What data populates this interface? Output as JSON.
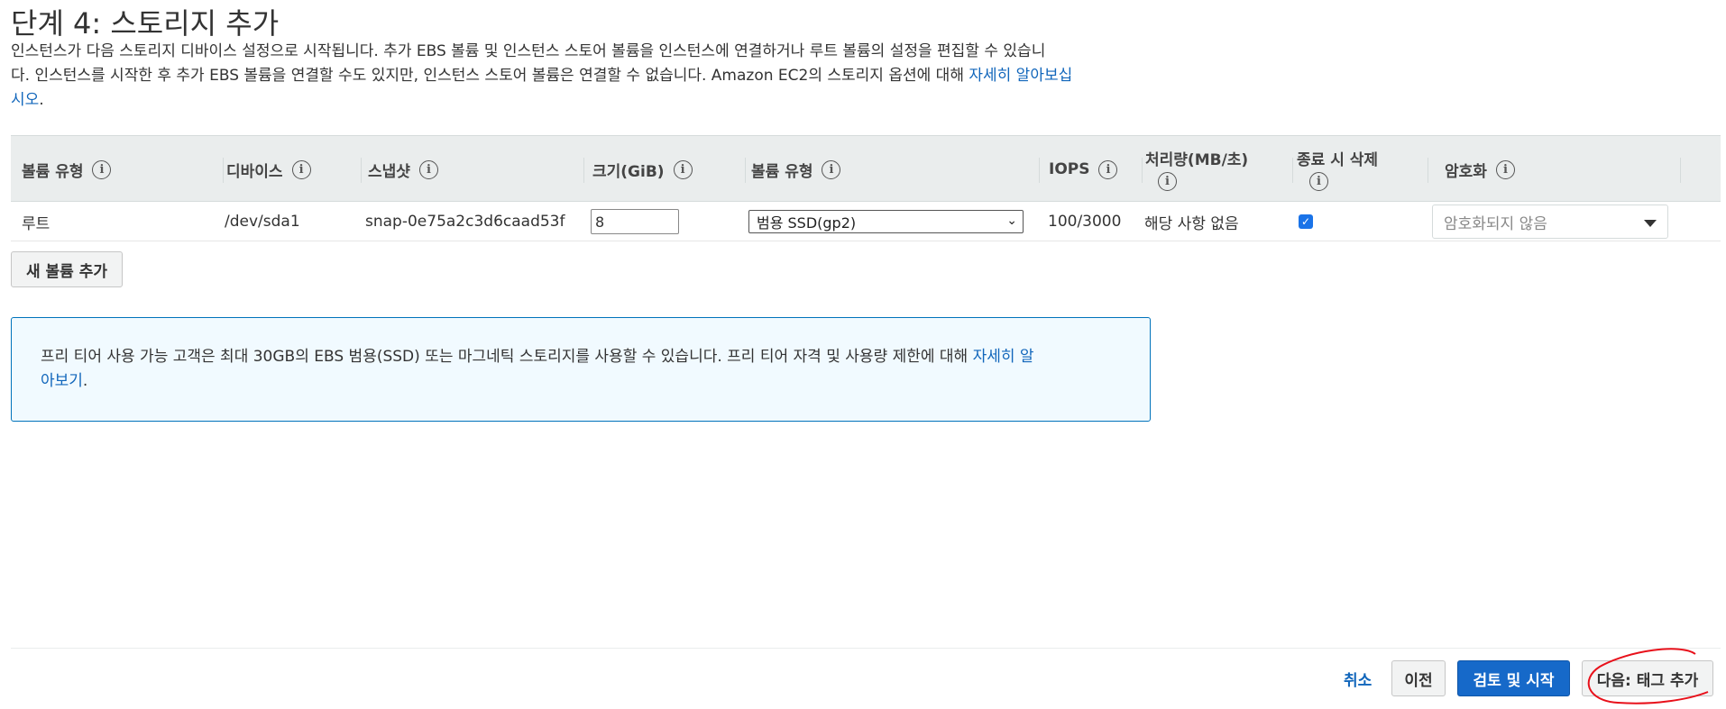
{
  "page": {
    "title": "단계 4: 스토리지 추가",
    "desc_line1": "인스턴스가 다음 스토리지 디바이스 설정으로 시작됩니다. 추가 EBS 볼륨 및 인스턴스 스토어 볼륨을 인스턴스에 연결하거나 루트 볼륨의 설정을 편집할 수 있습니",
    "desc_line2": "다. 인스턴스를 시작한 후 추가 EBS 볼륨을 연결할 수도 있지만, 인스턴스 스토어 볼륨은 연결할 수 없습니다. Amazon EC2의 스토리지 옵션에 대해 ",
    "desc_link_part1": "자세히 알아보십",
    "desc_link_part2": "시오",
    "desc_end": "."
  },
  "table": {
    "headers": {
      "volume_type": "볼륨 유형",
      "device": "디바이스",
      "snapshot": "스냅샷",
      "size": "크기(GiB)",
      "vol_type": "볼륨 유형",
      "iops": "IOPS",
      "throughput": "처리량(MB/초)",
      "delete_on_termination": "종료 시 삭제",
      "encryption": "암호화"
    },
    "info_glyph": "i",
    "row": {
      "volume_type": "루트",
      "device": "/dev/sda1",
      "snapshot": "snap-0e75a2c3d6caad53f",
      "size": "8",
      "vol_type": "범용 SSD(gp2)",
      "iops": "100/3000",
      "throughput": "해당 사항 없음",
      "delete_on_termination": true,
      "encryption": "암호화되지 않음"
    }
  },
  "add_volume_label": "새 볼륨 추가",
  "notice": {
    "text": "프리 티어 사용 가능 고객은 최대 30GB의 EBS 범용(SSD) 또는 마그네틱 스토리지를 사용할 수 있습니다. 프리 티어 자격 및 사용량 제한에 대해 ",
    "link_part1": "자세히 알",
    "link_part2": "아보기",
    "end": "."
  },
  "footer": {
    "cancel": "취소",
    "previous": "이전",
    "review_launch": "검토 및 시작",
    "next": "다음: 태그 추가"
  },
  "colors": {
    "link": "#1166bb",
    "primary": "#1669c9",
    "notice_bg": "#f1faff",
    "annotation": "#e8101a"
  },
  "icons": {
    "info": "info-circle-icon",
    "select_chevron": "chevron-down-icon",
    "checkbox": "checkmark-icon"
  }
}
